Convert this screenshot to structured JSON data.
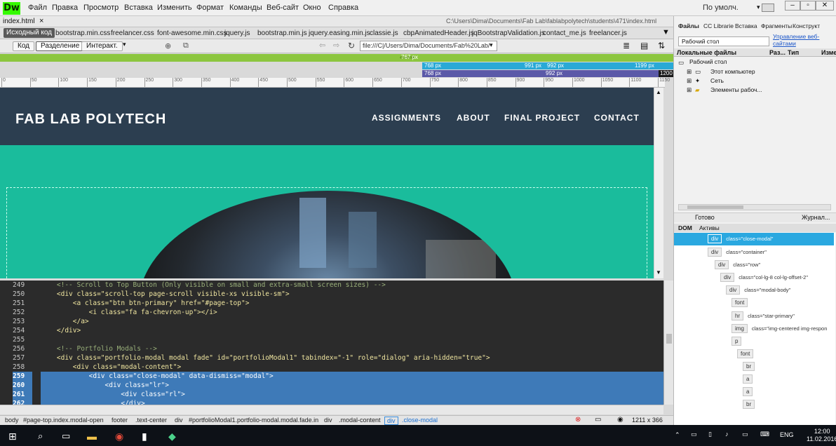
{
  "app": {
    "logo": "Dw",
    "menu": [
      "Файл",
      "Правка",
      "Просмотр",
      "Вставка",
      "Изменить",
      "Формат",
      "Команды",
      "Веб-сайт",
      "Окно",
      "Справка"
    ],
    "workspace": "По умолч."
  },
  "doc": {
    "tab": "index.html",
    "close": "×",
    "path": "C:\\Users\\Dima\\Documents\\Fab Lab\\fablabpolytech\\students\\471\\index.html"
  },
  "related": [
    "Исходный код",
    "bootstrap.min.css",
    "freelancer.css",
    "font-awesome.min.css",
    "jquery.js",
    "bootstrap.min.js",
    "jquery.easing.min.js",
    "classie.js",
    "cbpAnimatedHeader.js",
    "jqBootstrapValidation.js",
    "contact_me.js",
    "freelancer.js"
  ],
  "toolbar": {
    "code": "Код",
    "split": "Разделение",
    "live": "Интеракт.",
    "url": "file:///C|/Users/Dima/Documents/Fab%20Lab/"
  },
  "mq": {
    "r1": "767 px",
    "r2a": "768 px",
    "r2b": "991 px",
    "r2c": "992 px",
    "r2d": "1199 px",
    "r3a": "768 px",
    "r3b": "992 px",
    "r3c": "1200"
  },
  "ruler": [
    "0",
    "50",
    "100",
    "150",
    "200",
    "250",
    "300",
    "350",
    "400",
    "450",
    "500",
    "550",
    "600",
    "650",
    "700",
    "750",
    "800",
    "850",
    "900",
    "950",
    "1000",
    "1050",
    "1100",
    "1150"
  ],
  "site": {
    "brand": "FAB LAB POLYTECH",
    "nav": [
      "ASSIGNMENTS",
      "ABOUT",
      "FINAL PROJECT",
      "CONTACT"
    ]
  },
  "code": {
    "lines": [
      {
        "n": "249",
        "t": "    <!-- Scroll to Top Button (Only visible on small and extra-small screen sizes) -->"
      },
      {
        "n": "250",
        "t": "    <div class=\"scroll-top page-scroll visible-xs visible-sm\">"
      },
      {
        "n": "251",
        "t": "        <a class=\"btn btn-primary\" href=\"#page-top\">"
      },
      {
        "n": "252",
        "t": "            <i class=\"fa fa-chevron-up\"></i>"
      },
      {
        "n": "253",
        "t": "        </a>"
      },
      {
        "n": "254",
        "t": "    </div>"
      },
      {
        "n": "255",
        "t": ""
      },
      {
        "n": "256",
        "t": "    <!-- Portfolio Modals -->"
      },
      {
        "n": "257",
        "t": "    <div class=\"portfolio-modal modal fade\" id=\"portfolioModal1\" tabindex=\"-1\" role=\"dialog\" aria-hidden=\"true\">"
      },
      {
        "n": "258",
        "t": "        <div class=\"modal-content\">"
      },
      {
        "n": "259",
        "t": "            <div class=\"close-modal\" data-dismiss=\"modal\">"
      },
      {
        "n": "260",
        "t": "                <div class=\"lr\">"
      },
      {
        "n": "261",
        "t": "                    <div class=\"rl\">"
      },
      {
        "n": "262",
        "t": "                    </div>"
      }
    ]
  },
  "status": {
    "tags": [
      "body",
      "#page-top.index.modal-open",
      "footer",
      ".text-center",
      "div",
      "#portfolioModal1.portfolio-modal.modal.fade.in",
      "div",
      ".modal-content",
      "div",
      ".close-modal"
    ],
    "size": "1211 x 366"
  },
  "panel": {
    "tabs": [
      "Файлы",
      "CC Librarie",
      "Вставка",
      "Фрагменты",
      "Конструкт"
    ],
    "site": "Рабочий стол",
    "manage": "Управление веб-сайтами",
    "cols": [
      "Локальные файлы",
      "Раз...",
      "Тип",
      "Изме"
    ],
    "tree": [
      "Рабочий стол",
      "Этот компьютер",
      "Сеть",
      "Элементы рабоч..."
    ],
    "ready": "Готово",
    "log": "Журнал...",
    "domtabs": [
      "DOM",
      "Активы"
    ],
    "dom": [
      {
        "tag": "div",
        "attr": "class=\"close-modal\""
      },
      {
        "tag": "div",
        "attr": "class=\"container\""
      },
      {
        "tag": "div",
        "attr": "class=\"row\""
      },
      {
        "tag": "div",
        "attr": "class=\"col-lg-8 col-lg-offset-2\""
      },
      {
        "tag": "div",
        "attr": "class=\"modal-body\""
      },
      {
        "tag": "font",
        "attr": ""
      },
      {
        "tag": "hr",
        "attr": "class=\"star-primary\""
      },
      {
        "tag": "img",
        "attr": "class=\"img-centered img-respon"
      },
      {
        "tag": "p",
        "attr": ""
      },
      {
        "tag": "font",
        "attr": ""
      },
      {
        "tag": "br",
        "attr": ""
      },
      {
        "tag": "a",
        "attr": ""
      },
      {
        "tag": "a",
        "attr": ""
      },
      {
        "tag": "br",
        "attr": ""
      }
    ]
  },
  "taskbar": {
    "lang": "ENG",
    "time": "12:00",
    "date": "11.02.2016"
  }
}
